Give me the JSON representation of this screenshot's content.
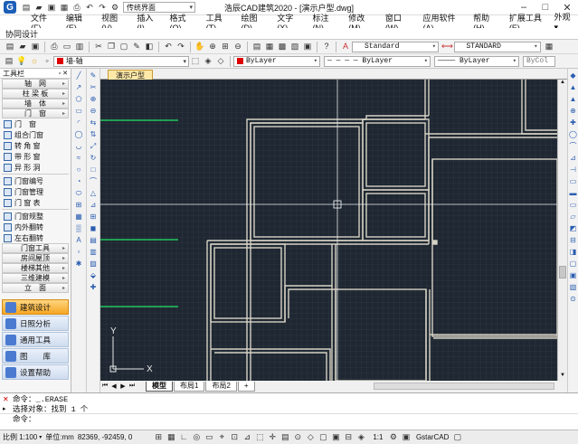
{
  "app": {
    "title": "浩辰CAD建筑2020 - [演示户型.dwg]",
    "ui_mode": "传统界面",
    "logo": "G"
  },
  "menu": [
    "文件(F)",
    "编辑(E)",
    "视图(V)",
    "插入(I)",
    "格式(O)",
    "工具(T)",
    "绘图(D)",
    "文字(X)",
    "标注(N)",
    "修改(M)",
    "窗口(W)",
    "应用软件(A)",
    "帮助(H)",
    "扩展工具(E)"
  ],
  "menu_right": "外观▾",
  "collab": "协同设计",
  "toolbar": {
    "text_style": "Standard",
    "dim_style": "STANDARD",
    "layer": "墙-轴",
    "color": "ByLayer",
    "linetype": "— — — — ByLayer",
    "lineweight": "———— ByLayer",
    "plotstyle": "ByCol"
  },
  "left_panel": {
    "title": "工具栏",
    "sections_top": [
      "轴　网",
      "柱 梁 板",
      "墙　体",
      "门　窗"
    ],
    "door_items": [
      "门　窗",
      "组合门窗",
      "转 角 窗",
      "带 形 窗",
      "异 形 洞"
    ],
    "door_items2": [
      "门窗编号",
      "门窗管理",
      "门 窗 表"
    ],
    "door_items3": [
      "门窗规整",
      "内外翻转",
      "左右翻转"
    ],
    "door_tools": "门窗工具",
    "sections_bottom": [
      "房间屋顶",
      "楼梯其他",
      "三维建模",
      "立　面"
    ],
    "big_tabs": [
      "建筑设计",
      "日照分析",
      "通用工具",
      "图　　库",
      "设置帮助"
    ]
  },
  "doc_tab": "演示户型",
  "layout_tabs": [
    "模型",
    "布局1",
    "布局2",
    "+"
  ],
  "command": {
    "line1": "命令：_.ERASE",
    "line2": "选择对象：找到 1 个",
    "prompt": "命令："
  },
  "status": {
    "scale": "比例 1:100",
    "units": "单位:mm",
    "coords": "82369, -92459, 0",
    "annotation_scale": "1:1",
    "brand": "GstarCAD"
  },
  "colors": {
    "canvas": "#1e2732",
    "wall": "#d6d2c4",
    "axis_green": "#22c55e",
    "accent": "#f5a623"
  }
}
